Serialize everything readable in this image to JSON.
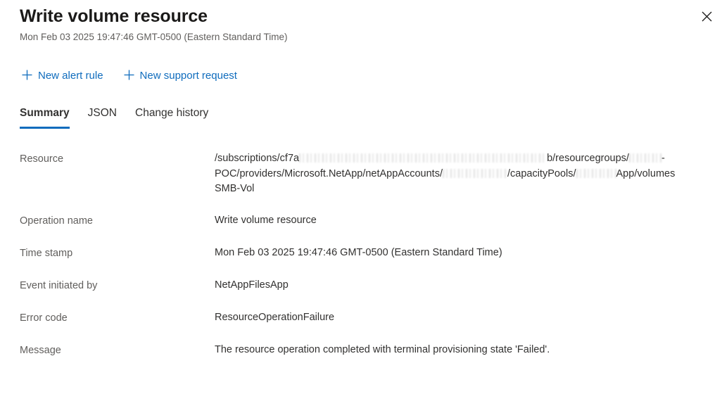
{
  "header": {
    "title": "Write volume resource",
    "subtitle": "Mon Feb 03 2025 19:47:46 GMT-0500 (Eastern Standard Time)",
    "close_label": "Close"
  },
  "command_bar": {
    "items": [
      {
        "label": "New alert rule",
        "icon": "plus-icon"
      },
      {
        "label": "New support request",
        "icon": "plus-icon"
      }
    ]
  },
  "tabs": [
    {
      "label": "Summary",
      "active": true
    },
    {
      "label": "JSON",
      "active": false
    },
    {
      "label": "Change history",
      "active": false
    }
  ],
  "properties": [
    {
      "label": "Resource",
      "value_type": "redacted_path",
      "path_line1_prefix": "/subscriptions/cf7a",
      "path_line1_middle": "b/resourcegroups/",
      "path_line1_suffix": "-",
      "path_line2_prefix": "POC/providers/Microsoft.NetApp/netAppAccounts/",
      "path_line2_middle": "/capacityPools/",
      "path_line2_suffix": "App/volumes",
      "path_line3": "SMB-Vol"
    },
    {
      "label": "Operation name",
      "value": "Write volume resource"
    },
    {
      "label": "Time stamp",
      "value": "Mon Feb 03 2025 19:47:46 GMT-0500 (Eastern Standard Time)"
    },
    {
      "label": "Event initiated by",
      "value": "NetAppFilesApp"
    },
    {
      "label": "Error code",
      "value": "ResourceOperationFailure"
    },
    {
      "label": "Message",
      "value": "The resource operation completed with terminal provisioning state 'Failed'."
    }
  ],
  "colors": {
    "accent": "#0f6cbd",
    "text_primary": "#323130",
    "text_secondary": "#605e5c",
    "background": "#ffffff"
  }
}
